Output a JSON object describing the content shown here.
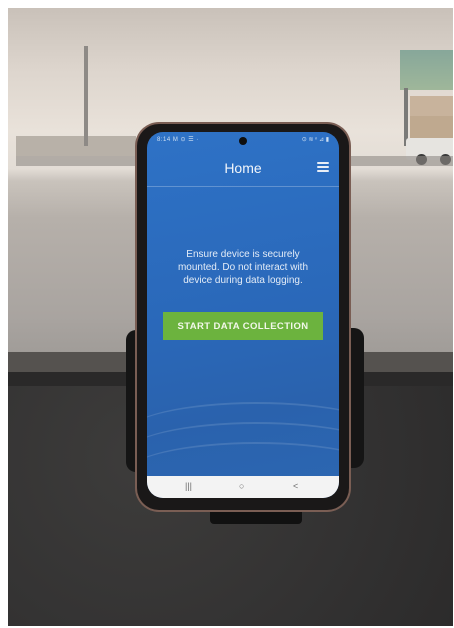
{
  "status_bar": {
    "left": "8:14 M ⊙ ☰ ·",
    "right": "⊙ ≋ ⁿ ⊿ ▮"
  },
  "header": {
    "title": "Home",
    "menu_icon": "hamburger-menu-icon"
  },
  "main": {
    "message": "Ensure device is securely mounted. Do not interact with device during data logging.",
    "start_button_label": "START DATA COLLECTION"
  },
  "nav_bar": {
    "recents": "|||",
    "home": "○",
    "back": "<"
  },
  "colors": {
    "screen_blue": "#2a68b9",
    "button_green": "#6cb33e"
  }
}
